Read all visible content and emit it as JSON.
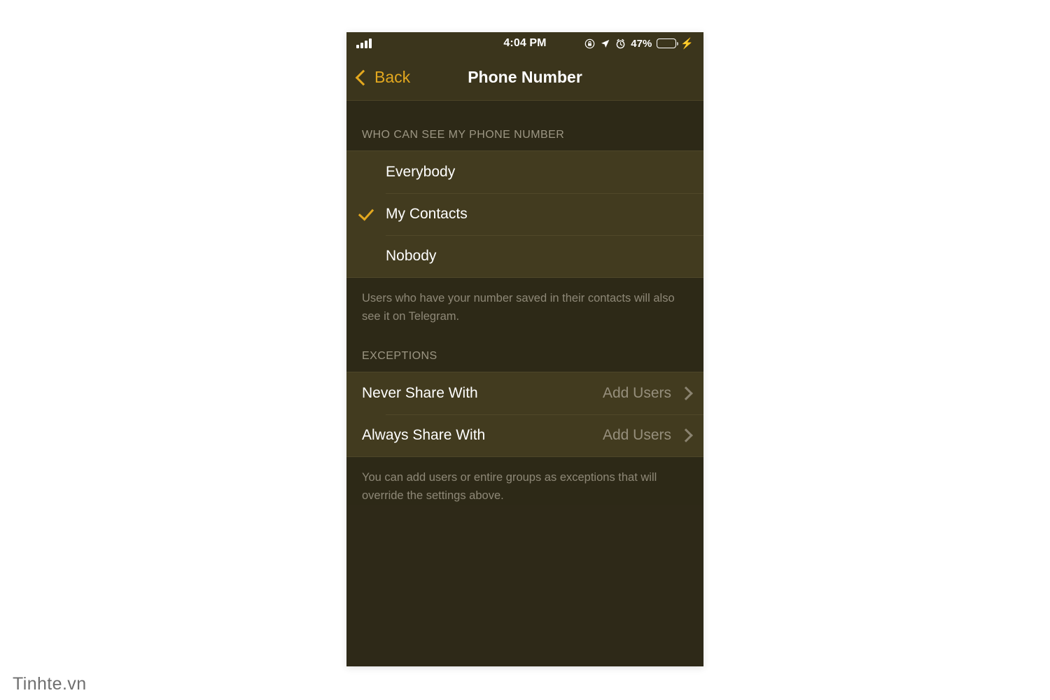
{
  "status_bar": {
    "signal_icon": "signal-bars-icon",
    "time": "4:04 PM",
    "orientation_lock_icon": "rotation-lock-icon",
    "location_icon": "location-arrow-icon",
    "alarm_icon": "alarm-clock-icon",
    "battery_percent": "47%",
    "battery_level": 47,
    "charging_icon": "lightning-bolt-icon",
    "battery_color": "#4cd662"
  },
  "nav": {
    "back_label": "Back",
    "back_icon": "chevron-left-icon",
    "title": "Phone Number",
    "accent_color": "#e3a81f"
  },
  "privacy_section": {
    "header": "WHO CAN SEE MY PHONE NUMBER",
    "options": [
      {
        "label": "Everybody",
        "selected": false
      },
      {
        "label": "My Contacts",
        "selected": true
      },
      {
        "label": "Nobody",
        "selected": false
      }
    ],
    "footer": "Users who have your number saved in their contacts will also see it on Telegram."
  },
  "exceptions_section": {
    "header": "EXCEPTIONS",
    "rows": [
      {
        "label": "Never Share With",
        "value": "Add Users",
        "chevron": "chevron-right-icon"
      },
      {
        "label": "Always Share With",
        "value": "Add Users",
        "chevron": "chevron-right-icon"
      }
    ],
    "footer": "You can add users or entire groups as exceptions that will override the settings above."
  },
  "watermark": {
    "text": "Tinhte.vn"
  },
  "theme": {
    "screen_bg": "#2e2918",
    "group_bg": "#423b1f",
    "header_bg": "#2d2917",
    "navbar_bg": "#3b351c",
    "accent": "#e3a81f",
    "muted_text": "#8e8877"
  }
}
